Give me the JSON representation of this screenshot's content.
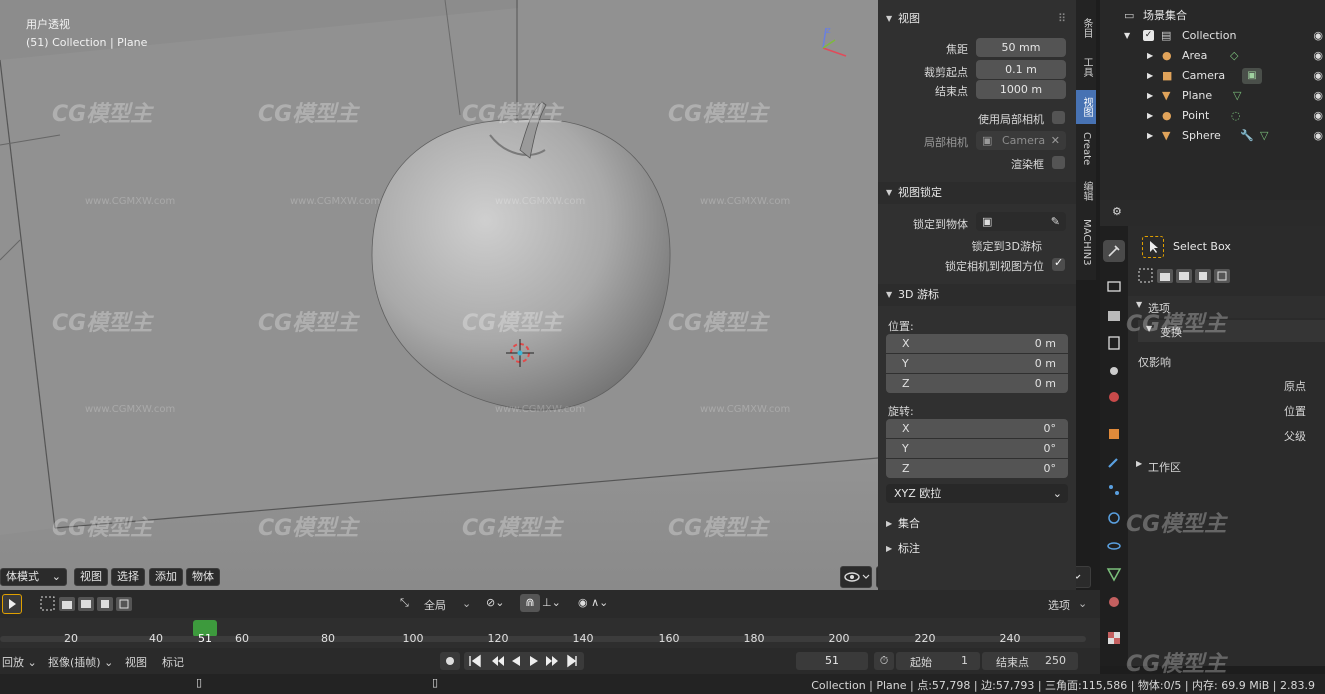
{
  "viewport": {
    "title": "用户透视",
    "subtitle": "(51) Collection | Plane",
    "menu": [
      "体模式",
      "视图",
      "选择",
      "添加",
      "物体"
    ],
    "watermark": "CG模型主",
    "watermark_url": "www.CGMXW.com"
  },
  "npanel": {
    "view": {
      "header": "视图",
      "focal_label": "焦距",
      "focal_value": "50 mm",
      "clip_start_label": "裁剪起点",
      "clip_start_value": "0.1 m",
      "clip_end_label": "结束点",
      "clip_end_value": "1000 m",
      "local_camera_label": "使用局部相机",
      "local_camera_field_label": "局部相机",
      "local_camera_value": "Camera",
      "render_border_label": "渲染框"
    },
    "view_lock": {
      "header": "视图锁定",
      "lock_object_label": "锁定到物体",
      "lock_3d_cursor_label": "锁定到3D游标",
      "lock_camera_label": "锁定相机到视图方位"
    },
    "cursor": {
      "header": "3D 游标",
      "location_label": "位置:",
      "rotation_label": "旋转:",
      "location": [
        [
          "X",
          "0 m"
        ],
        [
          "Y",
          "0 m"
        ],
        [
          "Z",
          "0 m"
        ]
      ],
      "rotation": [
        [
          "X",
          "0°"
        ],
        [
          "Y",
          "0°"
        ],
        [
          "Z",
          "0°"
        ]
      ],
      "rotation_mode": "XYZ 欧拉"
    },
    "collections_header": "集合",
    "annotations_header": "标注"
  },
  "tabs": [
    "条目",
    "工具",
    "视图",
    "Create",
    "编辑",
    "MACHIN3"
  ],
  "outliner": {
    "root": "场景集合",
    "collection": "Collection",
    "objects": [
      "Area",
      "Camera",
      "Plane",
      "Point",
      "Sphere"
    ]
  },
  "props": {
    "tool_name": "Select Box",
    "options_header": "选项",
    "transform_header": "变换",
    "affect_only": "仅影响",
    "origins": "原点",
    "locations": "位置",
    "parents": "父级",
    "workspace_header": "工作区"
  },
  "timeline": {
    "orientation": "全局",
    "options": "选项",
    "ticks": [
      "20",
      "40",
      "60",
      "80",
      "100",
      "120",
      "140",
      "160",
      "180",
      "200",
      "220",
      "240"
    ],
    "current_frame": "51",
    "menu": [
      "回放",
      "抠像(插帧)",
      "视图",
      "标记"
    ],
    "current_frame_field": "51",
    "start_label": "起始",
    "start_value": "1",
    "end_label": "结束点",
    "end_value": "250"
  },
  "status": "Collection | Plane | 点:57,798 | 边:57,793 | 三角面:115,586 | 物体:0/5  | 内存: 69.9 MiB | 2.83.9",
  "colors": {
    "accent": "#4772b3",
    "frame_marker": "#3d9a3d",
    "viewport_bg": "#8f8f8f"
  }
}
